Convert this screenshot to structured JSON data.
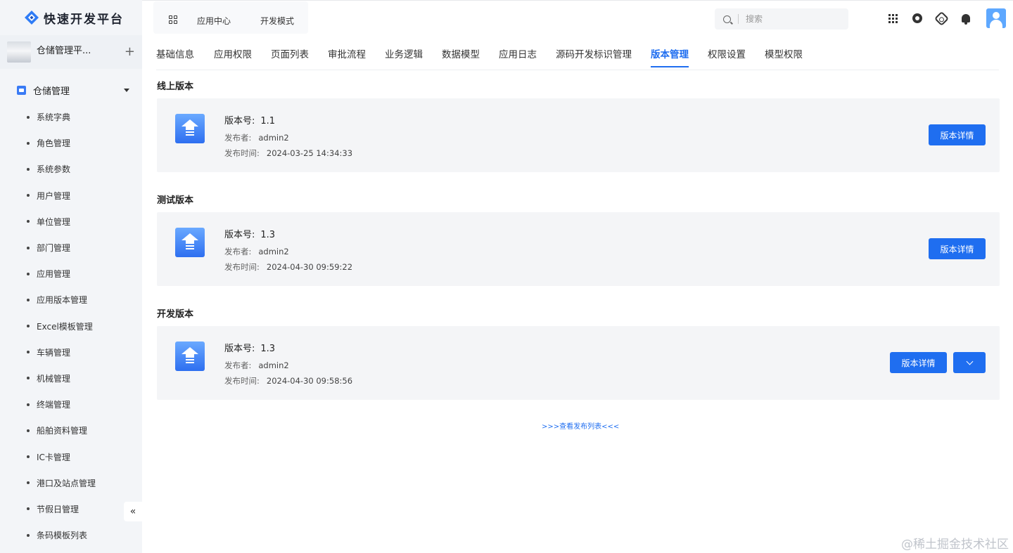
{
  "app": {
    "logo_text": "快速开发平台",
    "current_app": "仓储管理平...",
    "add_icon": "plus-icon"
  },
  "sidebar": {
    "group_label": "仓储管理",
    "items": [
      {
        "label": "系统字典"
      },
      {
        "label": "角色管理"
      },
      {
        "label": "系统参数"
      },
      {
        "label": "用户管理"
      },
      {
        "label": "单位管理"
      },
      {
        "label": "部门管理"
      },
      {
        "label": "应用管理"
      },
      {
        "label": "应用版本管理"
      },
      {
        "label": "Excel模板管理"
      },
      {
        "label": "车辆管理"
      },
      {
        "label": "机械管理"
      },
      {
        "label": "终端管理"
      },
      {
        "label": "船舶资料管理"
      },
      {
        "label": "IC卡管理"
      },
      {
        "label": "港口及站点管理"
      },
      {
        "label": "节假日管理"
      },
      {
        "label": "条码模板列表"
      }
    ],
    "collapse_label": "«"
  },
  "header": {
    "nav": [
      {
        "label": "应用中心"
      },
      {
        "label": "开发模式"
      }
    ],
    "search_placeholder": "搜索",
    "icons": [
      "apps-icon",
      "settings-icon",
      "config-icon",
      "bell-icon",
      "avatar-icon"
    ]
  },
  "tabs": [
    {
      "label": "基础信息"
    },
    {
      "label": "应用权限"
    },
    {
      "label": "页面列表"
    },
    {
      "label": "审批流程"
    },
    {
      "label": "业务逻辑"
    },
    {
      "label": "数据模型"
    },
    {
      "label": "应用日志"
    },
    {
      "label": "源码开发标识管理"
    },
    {
      "label": "版本管理",
      "active": true
    },
    {
      "label": "权限设置"
    },
    {
      "label": "模型权限"
    }
  ],
  "versions": [
    {
      "section_title": "线上版本",
      "version_label": "版本号:",
      "version": "1.1",
      "publisher_label": "发布者:",
      "publisher": "admin2",
      "time_label": "发布时间:",
      "time": "2024-03-25 14:34:33",
      "detail_button": "版本详情"
    },
    {
      "section_title": "测试版本",
      "version_label": "版本号:",
      "version": "1.3",
      "publisher_label": "发布者:",
      "publisher": "admin2",
      "time_label": "发布时间:",
      "time": "2024-04-30 09:59:22",
      "detail_button": "版本详情"
    },
    {
      "section_title": "开发版本",
      "version_label": "版本号:",
      "version": "1.3",
      "publisher_label": "发布者:",
      "publisher": "admin2",
      "time_label": "发布时间:",
      "time": "2024-04-30 09:58:56",
      "detail_button": "版本详情"
    }
  ],
  "view_list_link": ">>>查看发布列表<<<",
  "watermark": "@稀土掘金技术社区",
  "colors": {
    "accent": "#1f6ef0",
    "sidebar_bg": "#f3f5f8",
    "card_bg": "#f4f5f7"
  }
}
